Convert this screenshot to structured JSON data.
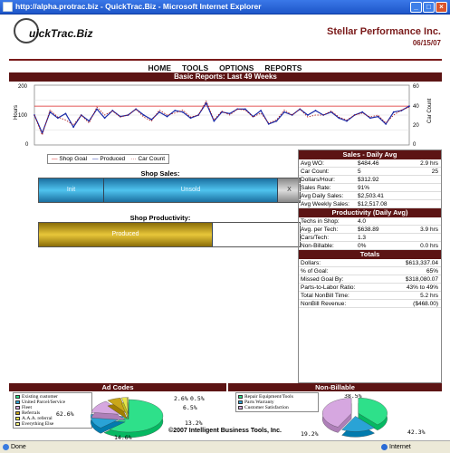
{
  "window": {
    "title": "http://alpha.protrac.biz - QuickTrac.Biz - Microsoft Internet Explorer"
  },
  "brand": {
    "logo": "uickTrac.Biz",
    "company": "Stellar Performance Inc.",
    "date": "06/15/07"
  },
  "nav": [
    "HOME",
    "TOOLS",
    "OPTIONS",
    "REPORTS"
  ],
  "report_title": "Basic Reports: Last 49 Weeks",
  "line_chart": {
    "yleft_label": "Hours",
    "yright_label": "Car Count",
    "yleft_ticks": [
      "200",
      "100",
      "0"
    ],
    "yright_ticks": [
      "60",
      "40",
      "20",
      "0"
    ],
    "legend": [
      "Shop Goal",
      "Produced",
      "Car Count"
    ]
  },
  "chart_data": {
    "type": "line",
    "x": [
      1,
      2,
      3,
      4,
      5,
      6,
      7,
      8,
      9,
      10,
      11,
      12,
      13,
      14,
      15,
      16,
      17,
      18,
      19,
      20,
      21,
      22,
      23,
      24,
      25,
      26,
      27,
      28,
      29,
      30,
      31,
      32,
      33,
      34,
      35,
      36,
      37,
      38,
      39,
      40,
      41,
      42,
      43,
      44,
      45,
      46,
      47,
      48,
      49
    ],
    "series": [
      {
        "name": "Shop Goal",
        "axis": "left",
        "values": [
          130,
          130,
          130,
          130,
          130,
          130,
          130,
          130,
          130,
          130,
          130,
          130,
          130,
          130,
          130,
          130,
          130,
          130,
          130,
          130,
          130,
          130,
          130,
          130,
          130,
          130,
          130,
          130,
          130,
          130,
          130,
          130,
          130,
          130,
          130,
          130,
          130,
          130,
          130,
          130,
          130,
          130,
          130,
          130,
          130,
          130,
          130,
          130,
          130
        ]
      },
      {
        "name": "Produced",
        "axis": "left",
        "values": [
          100,
          40,
          110,
          90,
          105,
          60,
          100,
          80,
          120,
          90,
          115,
          95,
          100,
          120,
          100,
          85,
          110,
          95,
          115,
          110,
          90,
          100,
          140,
          80,
          110,
          105,
          120,
          120,
          95,
          115,
          70,
          80,
          110,
          100,
          120,
          100,
          115,
          100,
          110,
          90,
          80,
          100,
          110,
          90,
          95,
          70,
          110,
          115,
          130
        ]
      },
      {
        "name": "Car Count",
        "axis": "right",
        "values": [
          30,
          10,
          35,
          28,
          25,
          20,
          30,
          22,
          38,
          30,
          34,
          28,
          30,
          36,
          28,
          24,
          35,
          30,
          32,
          35,
          28,
          30,
          44,
          25,
          34,
          30,
          36,
          35,
          28,
          32,
          22,
          25,
          35,
          30,
          36,
          28,
          30,
          30,
          34,
          28,
          25,
          30,
          32,
          28,
          30,
          22,
          30,
          35,
          38
        ]
      }
    ],
    "ylim_left": [
      0,
      200
    ],
    "ylim_right": [
      0,
      60
    ],
    "grid": true,
    "ylabel": "Hours",
    "ylabel_right": "Car Count"
  },
  "shop_sales": {
    "title": "Shop Sales:",
    "segments": [
      {
        "label": "Init",
        "fraction": 0.25,
        "color": "#2aa3d6"
      },
      {
        "label": "Unsold",
        "fraction": 0.66,
        "color": "#2aa3d6"
      },
      {
        "label": "X",
        "fraction": 0.09,
        "color": "#b0b0b0"
      }
    ]
  },
  "shop_productivity": {
    "title": "Shop Productivity:",
    "segments": [
      {
        "label": "Produced",
        "fraction": 0.66,
        "color": "#c9a619"
      }
    ]
  },
  "sales_daily": {
    "title": "Sales - Daily Avg",
    "rows": [
      {
        "k": "Avg WO:",
        "v": "$484.46",
        "u": "2.9 hrs"
      },
      {
        "k": "Car Count:",
        "v": "5",
        "u": "25"
      },
      {
        "k": "Dollars/Hour:",
        "v": "$312.92",
        "u": ""
      },
      {
        "k": "Sales Rate:",
        "v": "91%",
        "u": ""
      },
      {
        "k": "Avg Daily Sales:",
        "v": "$2,503.41",
        "u": ""
      },
      {
        "k": "Avg Weekly Sales:",
        "v": "$12,517.08",
        "u": ""
      }
    ]
  },
  "productivity": {
    "title": "Productivity (Daily Avg)",
    "rows": [
      {
        "k": "Techs in Shop:",
        "v": "4.0",
        "u": ""
      },
      {
        "k": "Avg. per Tech:",
        "v": "$638.89",
        "u": "3.9 hrs"
      },
      {
        "k": "Cars/Tech:",
        "v": "1.3",
        "u": ""
      },
      {
        "k": "Non-Billable:",
        "v": "0%",
        "u": "0.0 hrs"
      }
    ]
  },
  "totals": {
    "title": "Totals",
    "rows": [
      {
        "k": "Dollars:",
        "v": "$613,337.04"
      },
      {
        "k": "% of Goal:",
        "v": "65%"
      },
      {
        "k": "Missed Goal By:",
        "v": "$318,080.07"
      },
      {
        "k": "Parts-to-Labor Ratio:",
        "v": "43% to 49%"
      },
      {
        "k": "Total NonBill Time:",
        "v": "5.2 hrs"
      },
      {
        "k": "NonBill Revenue:",
        "v": "($468.00)"
      }
    ]
  },
  "ad_codes": {
    "title": "Ad Codes",
    "legend": [
      {
        "label": "Existing customer",
        "color": "#2ee08a"
      },
      {
        "label": "United Parcel/Service",
        "color": "#2aa3d6"
      },
      {
        "label": "Fleet",
        "color": "#d6a7e0"
      },
      {
        "label": "Referrals",
        "color": "#c9a619"
      },
      {
        "label": "A.A.A. referral",
        "color": "#e7e64a"
      },
      {
        "label": "Everything Else",
        "color": "#f5f27a"
      }
    ],
    "slices": [
      {
        "value": 62.6,
        "color": "#2ee08a"
      },
      {
        "value": 14.6,
        "color": "#2aa3d6"
      },
      {
        "value": 13.2,
        "color": "#d6a7e0"
      },
      {
        "value": 6.5,
        "color": "#c9a619"
      },
      {
        "value": 2.6,
        "color": "#e7e64a"
      },
      {
        "value": 0.5,
        "color": "#f5f27a"
      }
    ],
    "labels": [
      "62.6%",
      "14.6%",
      "13.2%",
      "6.5%",
      "2.6%",
      "0.5%"
    ]
  },
  "non_billable": {
    "title": "Non-Billable",
    "legend": [
      {
        "label": "Repair Equipment/Tools",
        "color": "#2ee08a"
      },
      {
        "label": "Parts Warranty",
        "color": "#2aa3d6"
      },
      {
        "label": "Customer Satisfaction",
        "color": "#d6a7e0"
      }
    ],
    "slices": [
      {
        "value": 38.5,
        "color": "#2ee08a"
      },
      {
        "value": 19.2,
        "color": "#2aa3d6"
      },
      {
        "value": 42.3,
        "color": "#d6a7e0"
      }
    ],
    "labels": [
      "38.5%",
      "19.2%",
      "42.3%"
    ]
  },
  "footer": "©2007 Intelligent Business Tools, Inc.",
  "status": {
    "left": "Done",
    "zone": "Internet"
  }
}
